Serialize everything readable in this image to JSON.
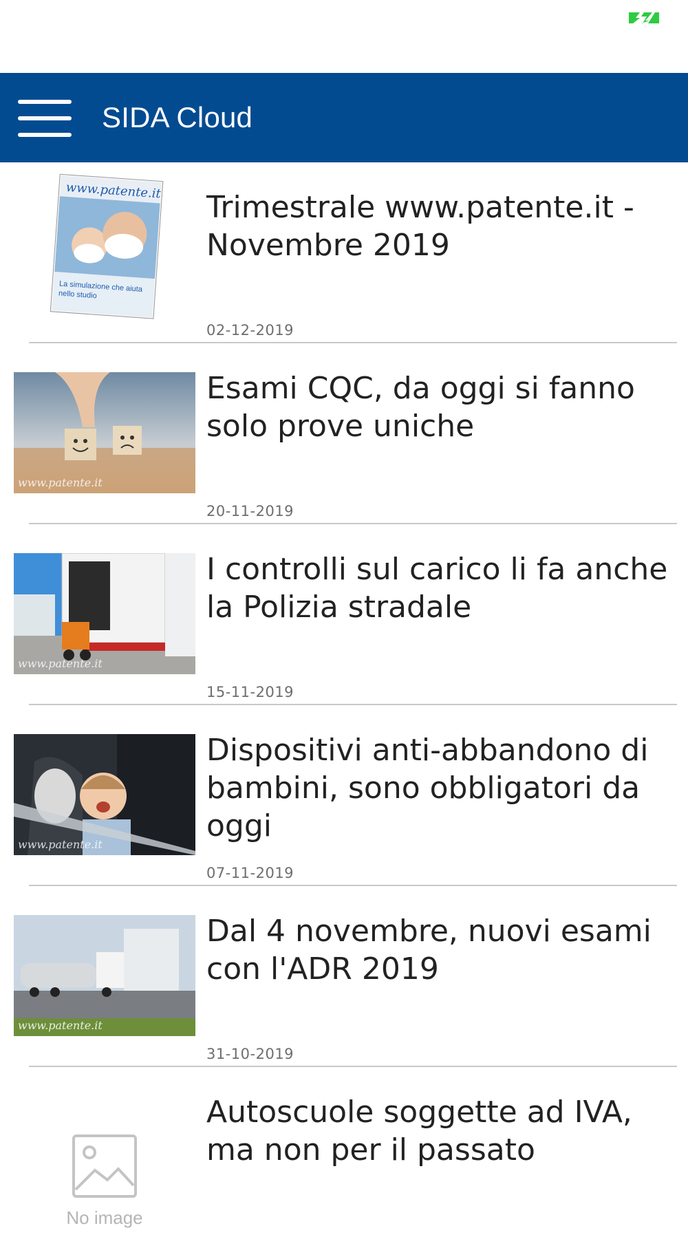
{
  "app": {
    "title": "SIDA Cloud",
    "accent_color": "#034b91",
    "menu_icon": "hamburger-menu-icon"
  },
  "statusbar": {
    "battery_color": "#2ecc40"
  },
  "articles": [
    {
      "title": "Trimestrale www.patente.it - Novembre 2019",
      "date": "02-12-2019",
      "thumb": "magazine-cover",
      "thumb_text": "www.patente.it"
    },
    {
      "title": "Esami CQC, da oggi si fanno solo prove uniche",
      "date": "20-11-2019",
      "thumb": "smiley-cubes-photo",
      "thumb_text": "www.patente.it"
    },
    {
      "title": "I controlli sul carico li fa anche la Polizia stradale",
      "date": "15-11-2019",
      "thumb": "truck-loading-photo",
      "thumb_text": "www.patente.it"
    },
    {
      "title": "Dispositivi anti-abbandono di bambini, sono obbligatori da oggi",
      "date": "07-11-2019",
      "thumb": "child-car-seat-photo",
      "thumb_text": "www.patente.it"
    },
    {
      "title": "Dal 4 novembre, nuovi esami con l'ADR 2019",
      "date": "31-10-2019",
      "thumb": "tanker-truck-photo",
      "thumb_text": "www.patente.it"
    },
    {
      "title": "Autoscuole soggette ad IVA, ma non per il passato",
      "date": "",
      "thumb": "no-image-placeholder",
      "thumb_text": "No image"
    }
  ]
}
